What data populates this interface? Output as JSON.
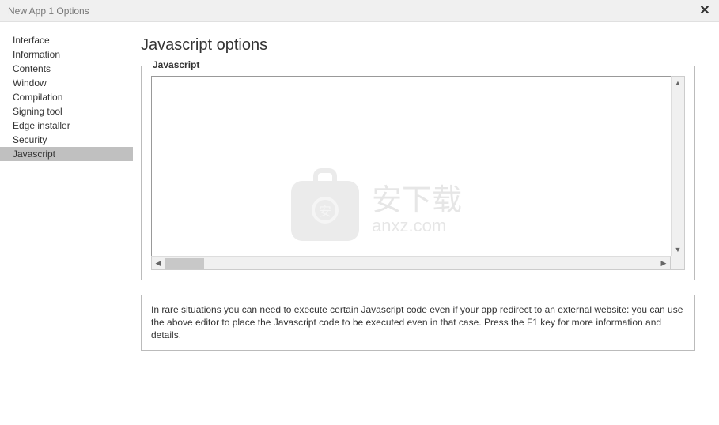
{
  "window": {
    "title": "New App 1 Options"
  },
  "sidebar": {
    "items": [
      {
        "label": "Interface",
        "selected": false
      },
      {
        "label": "Information",
        "selected": false
      },
      {
        "label": "Contents",
        "selected": false
      },
      {
        "label": "Window",
        "selected": false
      },
      {
        "label": "Compilation",
        "selected": false
      },
      {
        "label": "Signing tool",
        "selected": false
      },
      {
        "label": "Edge installer",
        "selected": false
      },
      {
        "label": "Security",
        "selected": false
      },
      {
        "label": "Javascript",
        "selected": true
      }
    ]
  },
  "page": {
    "title": "Javascript options",
    "fieldset_legend": "Javascript",
    "editor_value": "",
    "help_text": "In rare situations you can need to execute certain Javascript code even if your app redirect to an external website: you can use the above editor to place the Javascript code to be executed even in that case. Press the F1 key for more information and details."
  },
  "watermark": {
    "cn": "安下载",
    "en": "anxz.com",
    "badge_char": "安"
  }
}
